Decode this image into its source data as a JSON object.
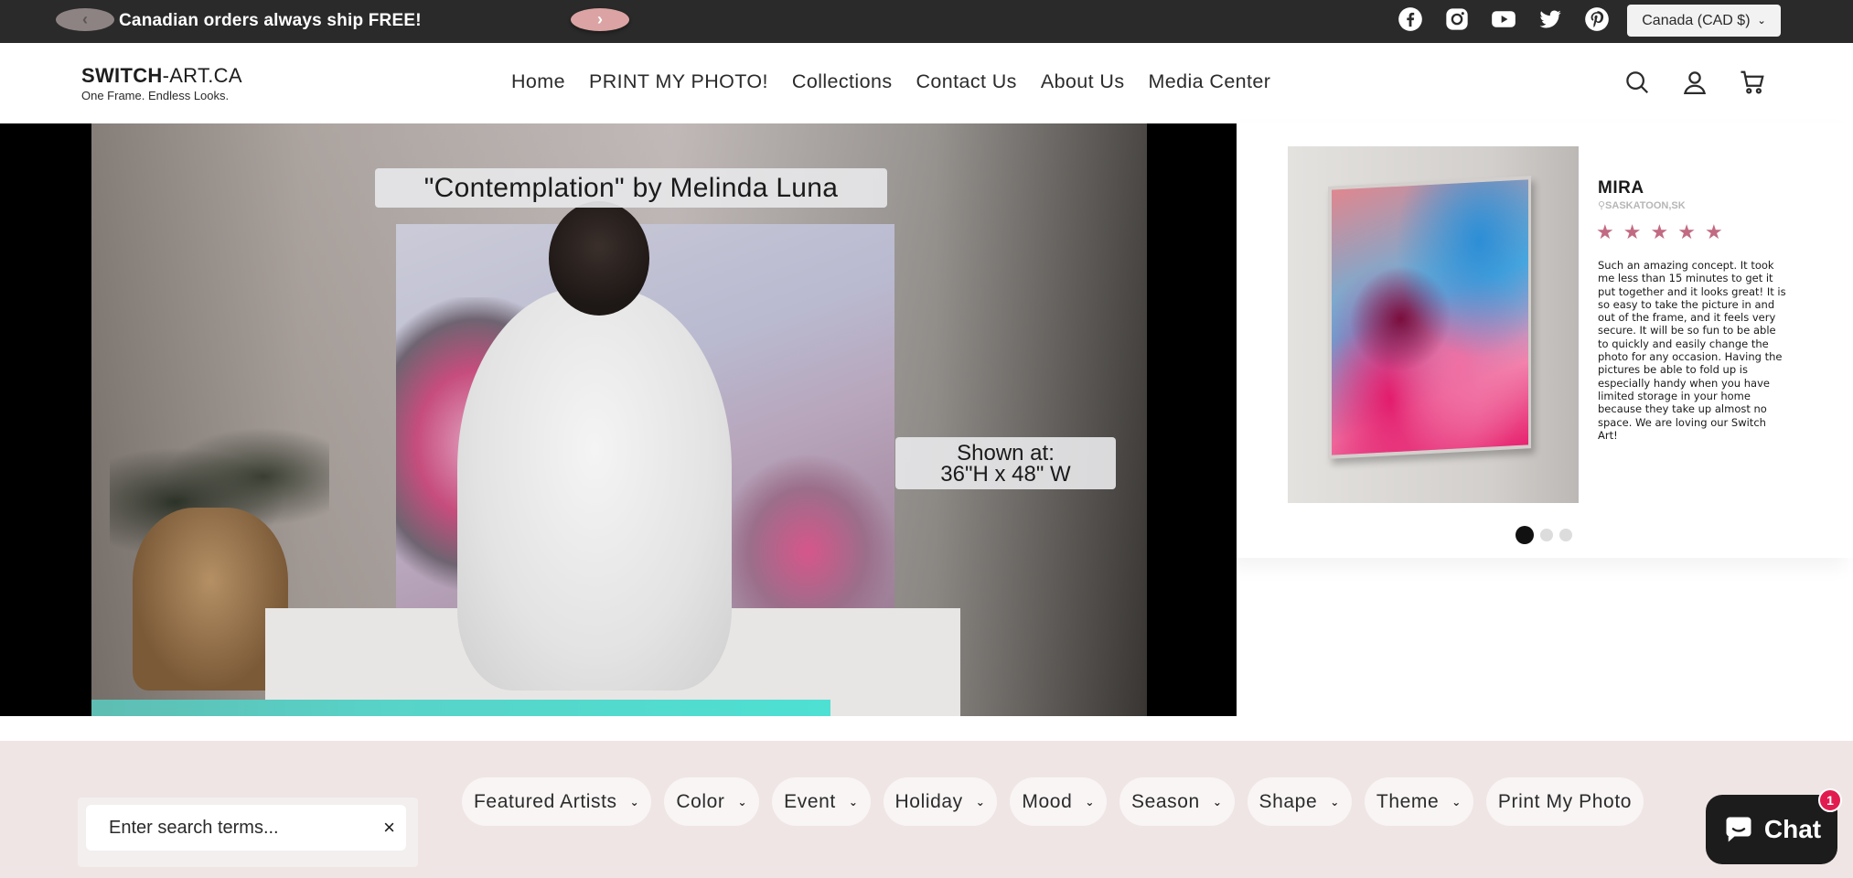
{
  "announcement": {
    "prev_icon": "‹",
    "next_icon": "›",
    "text": "Canadian orders always ship FREE!"
  },
  "socials": [
    "facebook-icon",
    "instagram-icon",
    "youtube-icon",
    "twitter-icon",
    "pinterest-icon"
  ],
  "currency": {
    "label": "Canada (CAD $)"
  },
  "header": {
    "logo_bold": "SWITCH",
    "logo_rest": "-ART.CA",
    "tagline": "One Frame. Endless Looks.",
    "nav": [
      "Home",
      "PRINT MY PHOTO!",
      "Collections",
      "Contact Us",
      "About Us",
      "Media Center"
    ]
  },
  "hero": {
    "title_overlay": "\"Contemplation\" by Melinda Luna",
    "size_line1": "Shown at:",
    "size_line2": "36\"H  x 48\" W",
    "progress": 0.7
  },
  "review": {
    "name": "MIRA",
    "location": "⚲SASKATOON,SK",
    "rating": 5,
    "text": "Such an amazing concept. It took me less than 15 minutes to get it put together and it looks great! It is so easy to take the picture in and out of the frame, and it feels very secure. It will be so fun to be able to quickly and easily change the photo for any occasion. Having the pictures be able to fold up is especially handy when you have limited storage in your home because they take up almost no space. We are loving our Switch Art!",
    "slides": 3,
    "active_slide": 1
  },
  "filters": {
    "search_placeholder": "Enter search terms...",
    "clear_icon": "×",
    "chips": [
      "Featured Artists",
      "Color",
      "Event",
      "Holiday",
      "Mood",
      "Season",
      "Shape",
      "Theme",
      "Print My Photo"
    ]
  },
  "chat": {
    "label": "Chat",
    "badge": "1"
  },
  "colors": {
    "announcement_bg": "#2a2a2a",
    "accent_pink": "#c26a83",
    "filter_band": "#efe5e5",
    "progress": "#4ee0d3",
    "badge": "#e11b4f"
  }
}
